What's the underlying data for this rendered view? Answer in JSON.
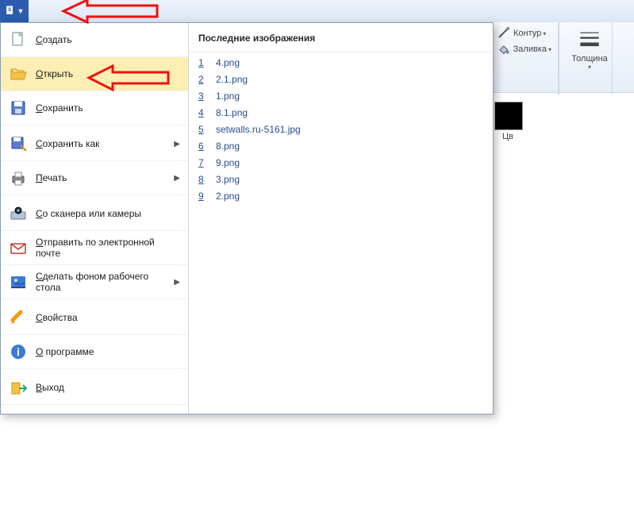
{
  "menu": {
    "items": [
      {
        "label": "Создать",
        "icon": "new",
        "hl": false
      },
      {
        "label": "Открыть",
        "icon": "open",
        "hl": true
      },
      {
        "label": "Сохранить",
        "icon": "save",
        "hl": false
      },
      {
        "label": "Сохранить как",
        "icon": "saveas",
        "sub": true
      },
      {
        "label": "Печать",
        "icon": "print",
        "sub": true
      },
      {
        "label": "Со сканера или камеры",
        "icon": "scanner"
      },
      {
        "label": "Отправить по электронной почте",
        "icon": "mail"
      },
      {
        "label": "Сделать фоном рабочего стола",
        "icon": "wallpaper",
        "sub": true
      },
      {
        "label": "Свойства",
        "icon": "props"
      },
      {
        "label": "О программе",
        "icon": "about"
      },
      {
        "label": "Выход",
        "icon": "exit"
      }
    ]
  },
  "recent": {
    "header": "Последние изображения",
    "items": [
      {
        "n": "1",
        "name": "4.png"
      },
      {
        "n": "2",
        "name": "2.1.png"
      },
      {
        "n": "3",
        "name": "1.png"
      },
      {
        "n": "4",
        "name": "8.1.png"
      },
      {
        "n": "5",
        "name": "setwalls.ru-5161.jpg"
      },
      {
        "n": "6",
        "name": "8.png"
      },
      {
        "n": "7",
        "name": "9.png"
      },
      {
        "n": "8",
        "name": "3.png"
      },
      {
        "n": "9",
        "name": "2.png"
      }
    ]
  },
  "ribbon": {
    "contour": "Контур",
    "fill": "Заливка",
    "thickness": "Толщина",
    "color_prefix": "Цв"
  }
}
